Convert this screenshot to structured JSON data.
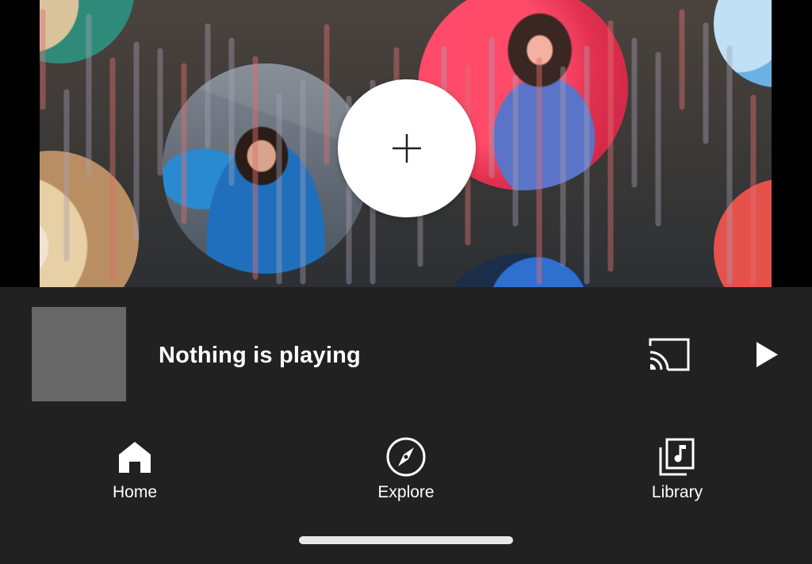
{
  "player": {
    "status_text": "Nothing is playing"
  },
  "nav": {
    "items": [
      {
        "label": "Home",
        "icon": "home-icon",
        "active": true
      },
      {
        "label": "Explore",
        "icon": "compass-icon",
        "active": false
      },
      {
        "label": "Library",
        "icon": "library-music-icon",
        "active": false
      }
    ]
  },
  "colors": {
    "background": "#212121",
    "thumbnail_placeholder": "#676767",
    "text": "#ffffff"
  }
}
